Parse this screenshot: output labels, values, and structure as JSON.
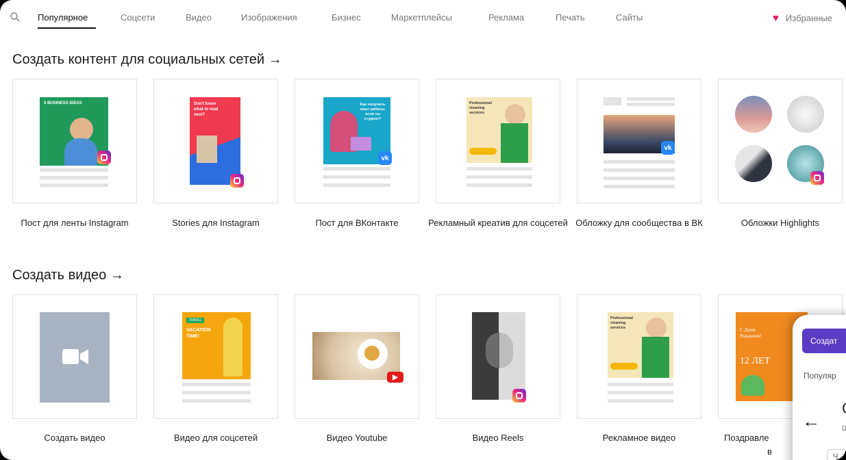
{
  "nav": {
    "tabs": [
      {
        "label": "Популярное",
        "active": true
      },
      {
        "label": "Соцсети"
      },
      {
        "label": "Видео"
      },
      {
        "label": "Изображения"
      },
      {
        "label": "Бизнес"
      },
      {
        "label": "Маркетплейсы"
      },
      {
        "label": "Реклама"
      },
      {
        "label": "Печать"
      },
      {
        "label": "Сайты"
      }
    ],
    "favorites_label": "Избранные"
  },
  "social": {
    "title": "Создать контент для социальных сетей →",
    "cards": [
      {
        "label": "Пост для ленты Instagram",
        "thumb_text": "5 BUSINESS IDEAS"
      },
      {
        "label": "Stories для Instagram",
        "thumb_text": "Don't know what to read next?"
      },
      {
        "label": "Пост для ВКонтакте",
        "thumb_text": "Как получить опыт работы, если ты студент?"
      },
      {
        "label": "Рекламный креатив для соцсетей",
        "thumb_text": "Professional cleaning services"
      },
      {
        "label": "Обложку для сообщества в ВК"
      },
      {
        "label": "Обложки Highlights"
      }
    ]
  },
  "video": {
    "title": "Создать видео →",
    "cards": [
      {
        "label": "Создать видео"
      },
      {
        "label": "Видео для соцсетей",
        "thumb_text": "VACATION TIME!",
        "thumb_tag": "TRAVEL"
      },
      {
        "label": "Видео Youtube"
      },
      {
        "label": "Видео Reels"
      },
      {
        "label": "Рекламное видео",
        "thumb_text": "Professional cleaning services"
      },
      {
        "label": "Поздравле",
        "label2": "в",
        "thumb_text": "С Днем Рождения!",
        "thumb_number": "12 ЛЕТ"
      }
    ]
  },
  "panel": {
    "create_label": "Создат",
    "popular_label": "Популяр",
    "heading_letter": "С",
    "sub_letter": "Ш",
    "bottom_letter": "Ч"
  },
  "colors": {
    "accent_purple": "#5b3cc4",
    "heart": "#e0196b",
    "instagram": "#ee2a7b",
    "vk": "#2787f5",
    "youtube": "#e21c1c"
  }
}
